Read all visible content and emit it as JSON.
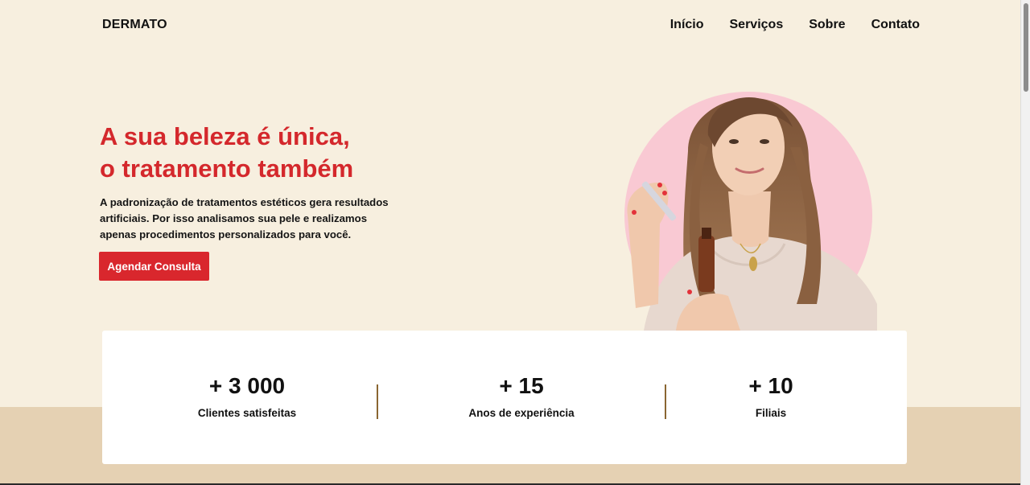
{
  "header": {
    "logo": "DERMATO",
    "nav": [
      "Início",
      "Serviços",
      "Sobre",
      "Contato"
    ]
  },
  "hero": {
    "title_line1": "A sua beleza é única,",
    "title_line2": "o tratamento também",
    "description": "A padronização de tratamentos estéticos gera resultados artificiais. Por isso analisamos sua pele e realizamos apenas procedimentos personalizados para você.",
    "cta_label": "Agendar Consulta"
  },
  "stats": [
    {
      "value": "+ 3 000",
      "label": "Clientes satisfeitas"
    },
    {
      "value": "+ 15",
      "label": "Anos de experiência"
    },
    {
      "value": "+ 10",
      "label": "Filiais"
    }
  ],
  "colors": {
    "accent": "#d9272d",
    "background": "#f7efdf",
    "band": "#e5d1b3",
    "divider": "#8a6632",
    "circle": "#f9c9d3"
  }
}
